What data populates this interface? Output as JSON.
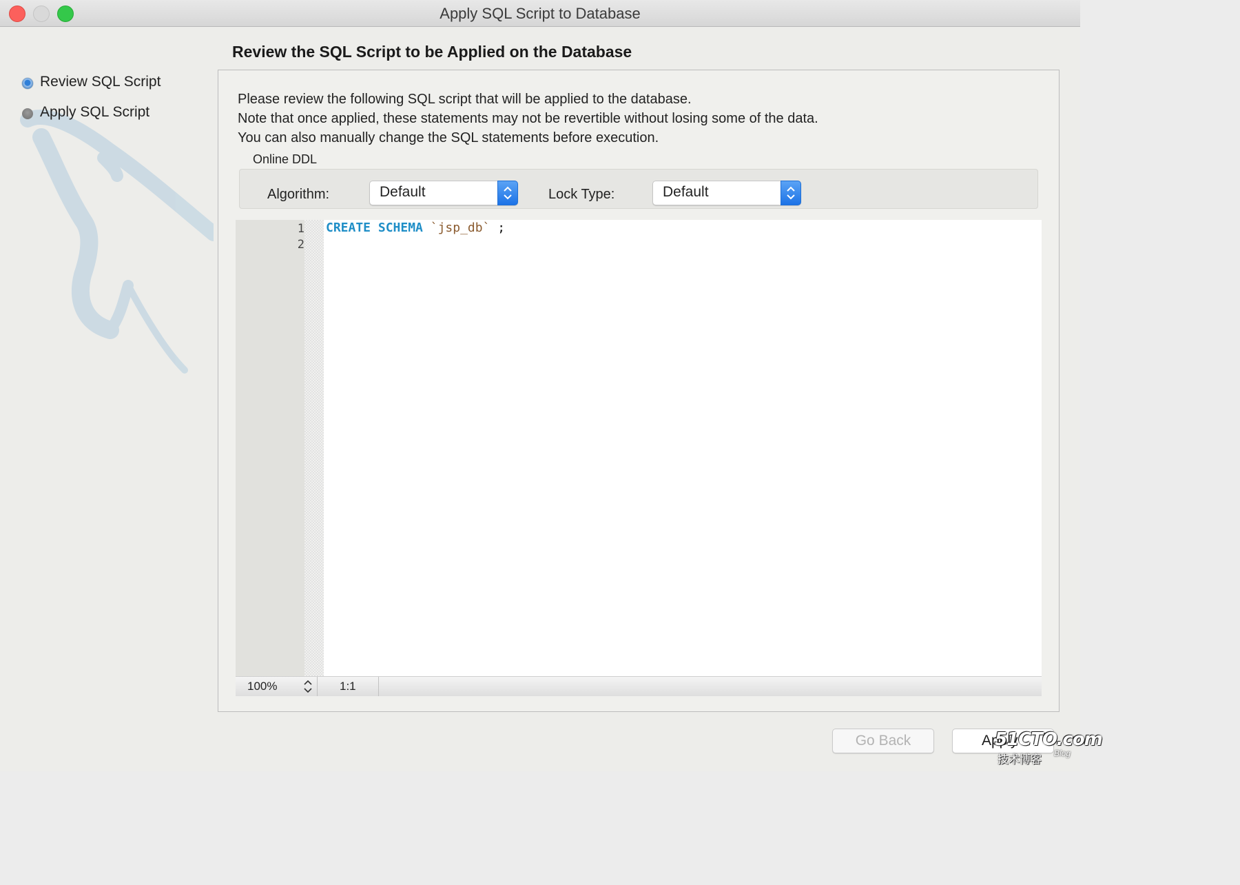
{
  "window": {
    "title": "Apply SQL Script to Database"
  },
  "sidebar": {
    "steps": [
      {
        "label": "Review SQL Script",
        "state": "active"
      },
      {
        "label": "Apply SQL Script",
        "state": "inactive"
      }
    ]
  },
  "main": {
    "heading": "Review the SQL Script to be Applied on the Database",
    "intro_lines": [
      "Please review the following SQL script that will be applied to the database.",
      "Note that once applied, these statements may not be revertible without losing some of the data.",
      "You can also manually change the SQL statements before execution."
    ],
    "online_ddl": {
      "group_label": "Online DDL",
      "algorithm_label": "Algorithm:",
      "algorithm_value": "Default",
      "lock_type_label": "Lock Type:",
      "lock_type_value": "Default"
    },
    "editor": {
      "line_numbers": [
        "1",
        "2"
      ],
      "code": {
        "keyword_1": "CREATE",
        "keyword_2": "SCHEMA",
        "identifier": "`jsp_db`",
        "terminator": ";"
      },
      "status": {
        "zoom": "100%",
        "cursor": "1:1"
      }
    }
  },
  "buttons": {
    "go_back": "Go Back",
    "apply": "Apply"
  },
  "watermark": {
    "brand": "51CTO.com",
    "sub": "技术博客",
    "blog": "Blog"
  },
  "colors": {
    "keyword": "#1f8ec7",
    "identifier": "#8a5a2e",
    "accent": "#1d73e6",
    "close": "#fc605c",
    "zoom": "#34c84a"
  }
}
